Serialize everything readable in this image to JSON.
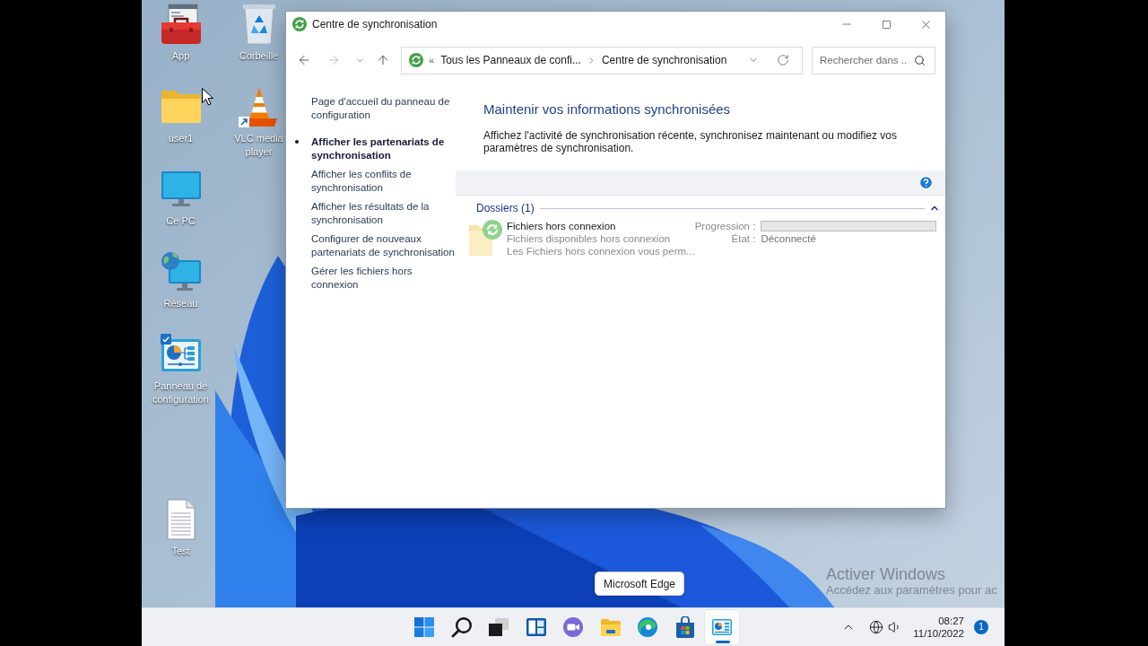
{
  "desktop": {
    "icons": [
      {
        "label": "App",
        "kind": "toolbox",
        "shortcut": false,
        "checked": false
      },
      {
        "label": "Corbeille",
        "kind": "recycle-bin",
        "shortcut": false,
        "checked": false
      },
      {
        "label": "user1",
        "kind": "folder",
        "shortcut": false,
        "checked": false
      },
      {
        "label": "VLC media player",
        "kind": "vlc",
        "shortcut": true,
        "checked": false
      },
      {
        "label": "Ce PC",
        "kind": "pc",
        "shortcut": false,
        "checked": false
      },
      {
        "label": "Réseau",
        "kind": "network",
        "shortcut": false,
        "checked": false
      },
      {
        "label": "Panneau de configuration",
        "kind": "control-panel",
        "shortcut": false,
        "checked": true
      },
      {
        "label": "Test",
        "kind": "document",
        "shortcut": false,
        "checked": false
      }
    ]
  },
  "window": {
    "title": "Centre de synchronisation",
    "nav_buttons": [
      {
        "kind": "back",
        "disabled": false
      },
      {
        "kind": "forward",
        "disabled": true
      },
      {
        "kind": "recent",
        "disabled": false
      },
      {
        "kind": "up",
        "disabled": false
      }
    ],
    "address": {
      "prefix": "«",
      "crumbs": [
        "Tous les Panneaux de confi...",
        "Centre de synchronisation"
      ]
    },
    "search": {
      "placeholder": "Rechercher dans ..."
    }
  },
  "sidebar": {
    "items": [
      {
        "label": "Page d'accueil du panneau de configuration",
        "kind": "home",
        "selected": false
      },
      {
        "label": "Afficher les partenariats de synchronisation",
        "kind": "task",
        "selected": true
      },
      {
        "label": "Afficher les conflits de synchronisation",
        "kind": "task",
        "selected": false
      },
      {
        "label": "Afficher les résultats de la synchronisation",
        "kind": "task",
        "selected": false
      },
      {
        "label": "Configurer de nouveaux partenariats de synchronisation",
        "kind": "task",
        "selected": false
      },
      {
        "label": "Gérer les fichiers hors connexion",
        "kind": "task",
        "selected": false
      }
    ]
  },
  "main": {
    "title": "Maintenir vos informations synchronisées",
    "description": "Affichez l'activité de synchronisation récente, synchronisez maintenant ou modifiez vos paramètres de synchronisation.",
    "group": {
      "label": "Dossiers (1)",
      "expanded": true,
      "items": [
        {
          "name": "Fichiers hors connexion",
          "subtitle": "Fichiers disponibles hors connexion",
          "details": "Les Fichiers hors connexion vous perm...",
          "progress_label": "Progression :",
          "level": 0,
          "status_label": "État :",
          "status": "Déconnecté"
        }
      ]
    }
  },
  "tooltip": {
    "text": "Microsoft Edge"
  },
  "taskbar": {
    "apps": [
      {
        "kind": "start",
        "active": false
      },
      {
        "kind": "search",
        "active": false
      },
      {
        "kind": "task-view",
        "active": false
      },
      {
        "kind": "widgets",
        "active": false
      },
      {
        "kind": "chat",
        "active": false
      },
      {
        "kind": "explorer",
        "active": false
      },
      {
        "kind": "edge",
        "active": false
      },
      {
        "kind": "store",
        "active": false
      },
      {
        "kind": "control-panel",
        "active": true
      }
    ],
    "clock": {
      "time": "08:27",
      "date": "11/10/2022"
    },
    "notifications": "1"
  },
  "activation_notice": {
    "title": "Activer Windows",
    "text": "Accédez aux paramètres pour ac"
  }
}
